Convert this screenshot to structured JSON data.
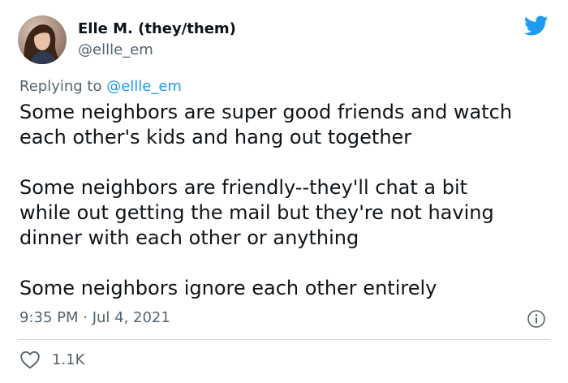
{
  "author": {
    "display_name": "Elle M. (they/them)",
    "handle": "@ellle_em"
  },
  "reply_context": {
    "prefix": "Replying to ",
    "mention": "@ellle_em"
  },
  "tweet": {
    "lines": [
      "Some neighbors are super good friends and watch",
      "each other's kids and hang out together",
      "",
      "Some neighbors are friendly--they'll chat a bit",
      "while out getting the mail but they're not having",
      "dinner with each other or anything",
      "",
      "Some neighbors ignore each other entirely"
    ],
    "timestamp": "9:35 PM · Jul 4, 2021"
  },
  "engagement": {
    "like_count": "1.1K"
  },
  "icons": {
    "brand": "twitter-bird-icon",
    "info": "info-icon",
    "like": "heart-icon"
  },
  "colors": {
    "brand_blue": "#1d9bf0",
    "text_primary": "#0f1419",
    "text_secondary": "#536471",
    "divider": "#cfd9de"
  }
}
